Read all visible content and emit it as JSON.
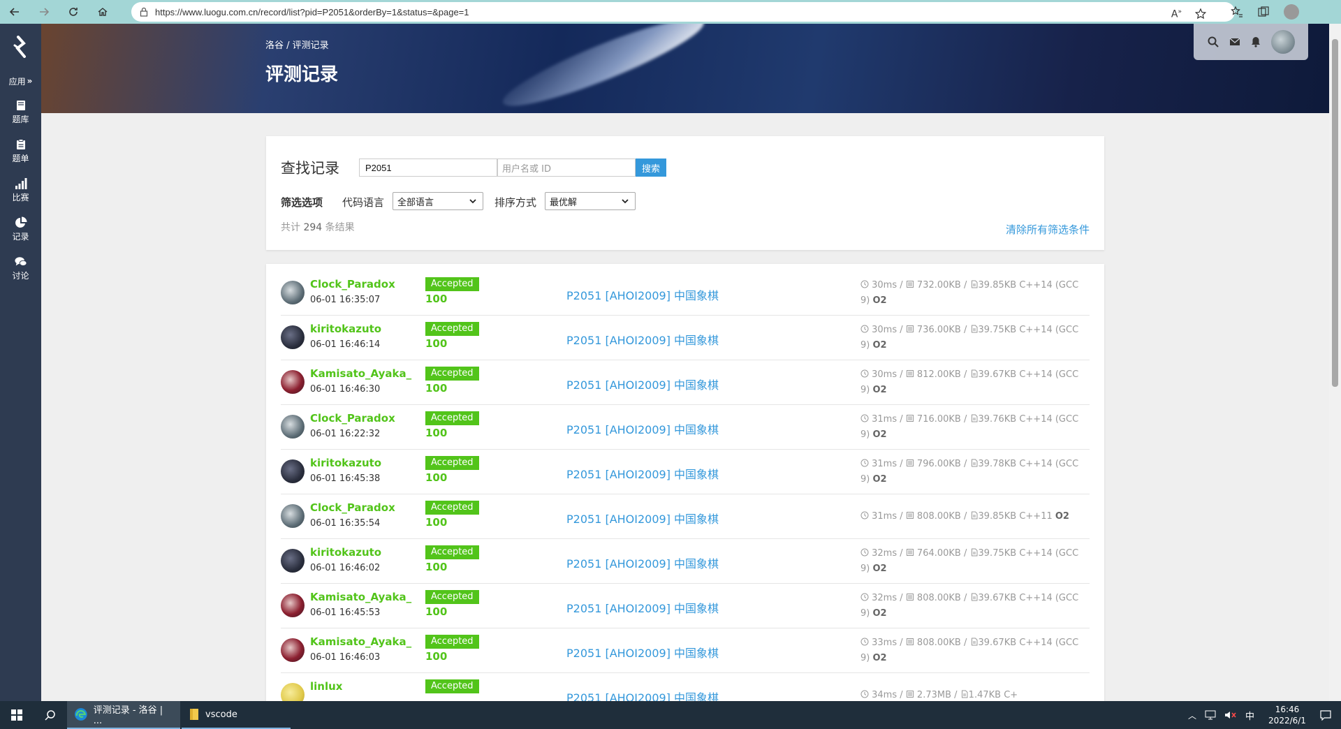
{
  "browser": {
    "url": "https://www.luogu.com.cn/record/list?pid=P2051&orderBy=1&status=&page=1",
    "read_aloud_label": "A",
    "read_aloud_sup": "»"
  },
  "sidebar": {
    "apps_label": "应用",
    "apps_arrow": "»",
    "items": [
      {
        "label": "题库",
        "icon": "book-icon"
      },
      {
        "label": "题单",
        "icon": "clipboard-icon"
      },
      {
        "label": "比赛",
        "icon": "bar-chart-icon"
      },
      {
        "label": "记录",
        "icon": "pie-chart-icon"
      },
      {
        "label": "讨论",
        "icon": "comments-icon"
      }
    ]
  },
  "header": {
    "breadcrumb": "洛谷 / 评测记录",
    "title": "评测记录"
  },
  "search": {
    "title": "查找记录",
    "pid_value": "P2051",
    "user_placeholder": "用户名或 ID",
    "button_label": "搜索",
    "filter_label": "筛选选项",
    "lang_label": "代码语言",
    "lang_value": "全部语言",
    "sort_label": "排序方式",
    "sort_value": "最优解",
    "total_prefix": "共计",
    "total_count": "294",
    "total_suffix": "条结果",
    "clear_label": "清除所有筛选条件"
  },
  "records": [
    {
      "user": "Clock_Paradox",
      "avatar": "clock",
      "time": "06-01 16:35:07",
      "status": "Accepted",
      "score": "100",
      "problem": "P2051 [AHOI2009] 中国象棋",
      "runtime": "30ms",
      "memory": "732.00KB",
      "size": "39.85KB",
      "lang": "C++14 (GCC",
      "lang2": "9)",
      "opt": "O2"
    },
    {
      "user": "kiritokazuto",
      "avatar": "kirito",
      "time": "06-01 16:46:14",
      "status": "Accepted",
      "score": "100",
      "problem": "P2051 [AHOI2009] 中国象棋",
      "runtime": "30ms",
      "memory": "736.00KB",
      "size": "39.75KB",
      "lang": "C++14 (GCC",
      "lang2": "9)",
      "opt": "O2"
    },
    {
      "user": "Kamisato_Ayaka_",
      "avatar": "ayaka",
      "time": "06-01 16:46:30",
      "status": "Accepted",
      "score": "100",
      "problem": "P2051 [AHOI2009] 中国象棋",
      "runtime": "30ms",
      "memory": "812.00KB",
      "size": "39.67KB",
      "lang": "C++14 (GCC",
      "lang2": "9)",
      "opt": "O2"
    },
    {
      "user": "Clock_Paradox",
      "avatar": "clock",
      "time": "06-01 16:22:32",
      "status": "Accepted",
      "score": "100",
      "problem": "P2051 [AHOI2009] 中国象棋",
      "runtime": "31ms",
      "memory": "716.00KB",
      "size": "39.76KB",
      "lang": "C++14 (GCC",
      "lang2": "9)",
      "opt": "O2"
    },
    {
      "user": "kiritokazuto",
      "avatar": "kirito",
      "time": "06-01 16:45:38",
      "status": "Accepted",
      "score": "100",
      "problem": "P2051 [AHOI2009] 中国象棋",
      "runtime": "31ms",
      "memory": "796.00KB",
      "size": "39.78KB",
      "lang": "C++14 (GCC",
      "lang2": "9)",
      "opt": "O2"
    },
    {
      "user": "Clock_Paradox",
      "avatar": "clock",
      "time": "06-01 16:35:54",
      "status": "Accepted",
      "score": "100",
      "problem": "P2051 [AHOI2009] 中国象棋",
      "runtime": "31ms",
      "memory": "808.00KB",
      "size": "39.85KB",
      "lang": "C++11",
      "lang2": "",
      "opt": "O2"
    },
    {
      "user": "kiritokazuto",
      "avatar": "kirito",
      "time": "06-01 16:46:02",
      "status": "Accepted",
      "score": "100",
      "problem": "P2051 [AHOI2009] 中国象棋",
      "runtime": "32ms",
      "memory": "764.00KB",
      "size": "39.75KB",
      "lang": "C++14 (GCC",
      "lang2": "9)",
      "opt": "O2"
    },
    {
      "user": "Kamisato_Ayaka_",
      "avatar": "ayaka",
      "time": "06-01 16:45:53",
      "status": "Accepted",
      "score": "100",
      "problem": "P2051 [AHOI2009] 中国象棋",
      "runtime": "32ms",
      "memory": "808.00KB",
      "size": "39.67KB",
      "lang": "C++14 (GCC",
      "lang2": "9)",
      "opt": "O2"
    },
    {
      "user": "Kamisato_Ayaka_",
      "avatar": "ayaka",
      "time": "06-01 16:46:03",
      "status": "Accepted",
      "score": "100",
      "problem": "P2051 [AHOI2009] 中国象棋",
      "runtime": "33ms",
      "memory": "808.00KB",
      "size": "39.67KB",
      "lang": "C++14 (GCC",
      "lang2": "9)",
      "opt": "O2"
    },
    {
      "user": "linlux",
      "avatar": "linlux",
      "time": "",
      "status": "Accepted",
      "score": "",
      "problem": "P2051 [AHOI2009] 中国象棋",
      "runtime": "34ms",
      "memory": "2.73MB",
      "size": "1.47KB",
      "lang": "C+",
      "lang2": "",
      "opt": ""
    }
  ],
  "taskbar": {
    "apps": [
      {
        "label": "评测记录 - 洛谷 | ...",
        "icon": "edge-icon"
      },
      {
        "label": "vscode",
        "icon": "folder-icon"
      }
    ],
    "ime": "中",
    "time": "16:46",
    "date": "2022/6/1"
  },
  "colors": {
    "sidebar": "#2e3b51",
    "accepted": "#52c41a",
    "link": "#3498db",
    "browser_bar": "#a3d6d6",
    "taskbar": "#1f2e3b"
  }
}
